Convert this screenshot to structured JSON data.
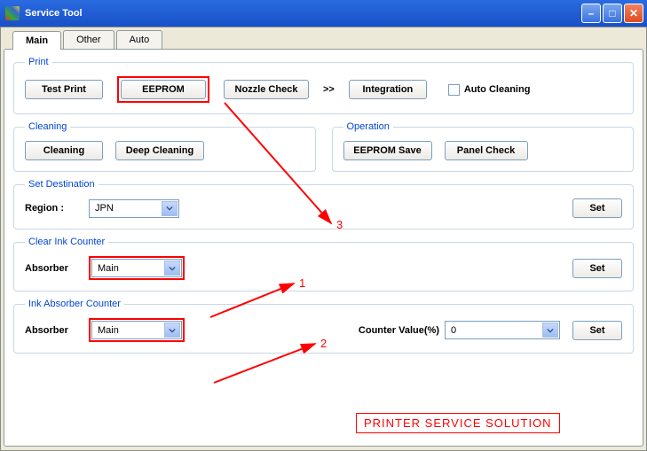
{
  "window": {
    "title": "Service Tool"
  },
  "tabs": {
    "main": "Main",
    "other": "Other",
    "auto": "Auto"
  },
  "print": {
    "legend": "Print",
    "test_print": "Test Print",
    "eeprom": "EEPROM",
    "nozzle_check": "Nozzle Check",
    "more": ">>",
    "integration": "Integration",
    "auto_cleaning": "Auto Cleaning"
  },
  "cleaning": {
    "legend": "Cleaning",
    "cleaning": "Cleaning",
    "deep": "Deep Cleaning"
  },
  "operation": {
    "legend": "Operation",
    "eeprom_save": "EEPROM Save",
    "panel_check": "Panel Check"
  },
  "set_dest": {
    "legend": "Set Destination",
    "region_label": "Region :",
    "region_value": "JPN",
    "set": "Set"
  },
  "clear_ink": {
    "legend": "Clear Ink Counter",
    "absorber_label": "Absorber",
    "absorber_value": "Main",
    "set": "Set"
  },
  "ink_abs": {
    "legend": "Ink Absorber Counter",
    "absorber_label": "Absorber",
    "absorber_value": "Main",
    "counter_label": "Counter Value(%)",
    "counter_value": "0",
    "set": "Set"
  },
  "annotations": {
    "n1": "1",
    "n2": "2",
    "n3": "3",
    "watermark": "PRINTER SERVICE SOLUTION"
  }
}
